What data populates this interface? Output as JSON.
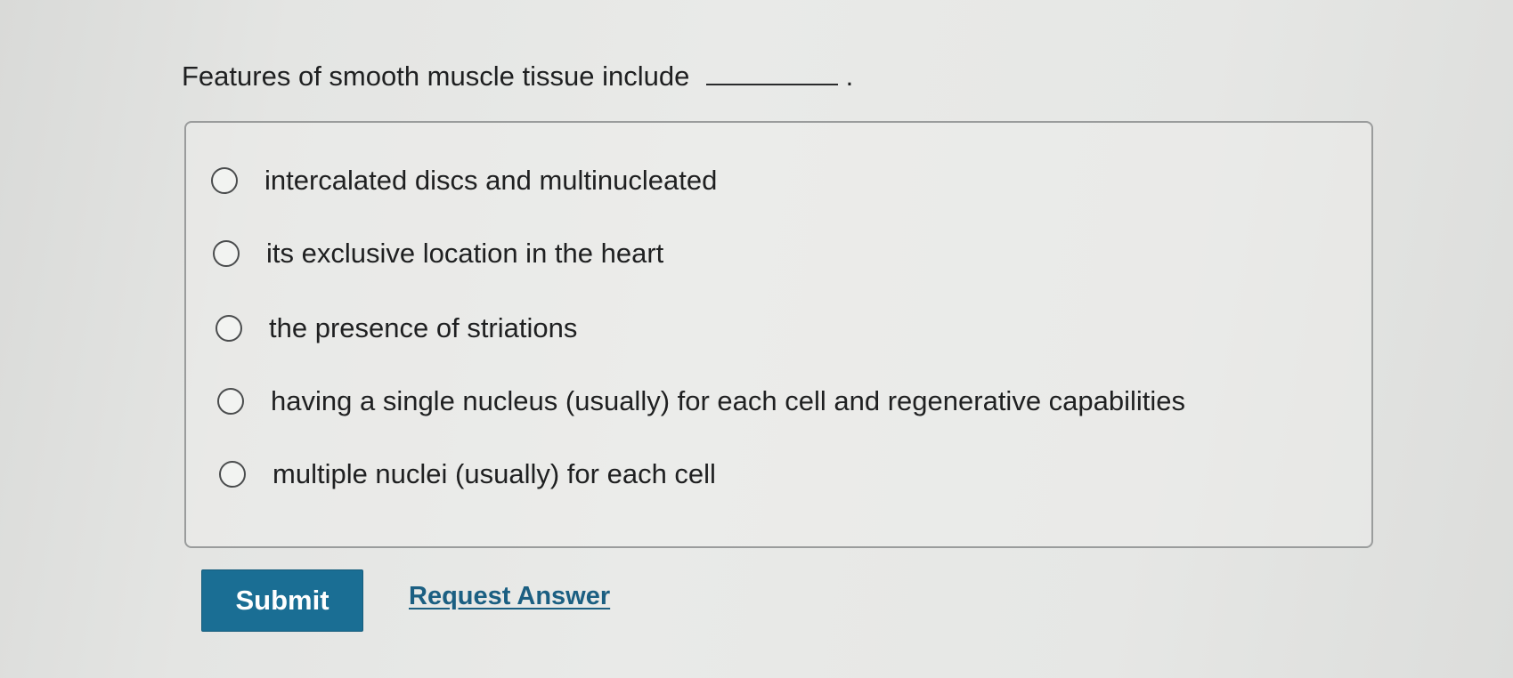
{
  "question": {
    "prompt": "Features of smooth muscle tissue include",
    "end_punctuation": "."
  },
  "options": [
    {
      "label": "intercalated discs and multinucleated",
      "selected": false
    },
    {
      "label": "its exclusive location in the heart",
      "selected": false
    },
    {
      "label": "the presence of striations",
      "selected": false
    },
    {
      "label": "having a single nucleus (usually) for each cell and regenerative capabilities",
      "selected": false
    },
    {
      "label": "multiple nuclei (usually) for each cell",
      "selected": false
    }
  ],
  "actions": {
    "submit_label": "Submit",
    "request_answer_label": "Request Answer"
  },
  "colors": {
    "submit_background": "#1a6e94",
    "link": "#1b5f82"
  },
  "icons": {
    "option_marker": "radio-button-icon"
  }
}
